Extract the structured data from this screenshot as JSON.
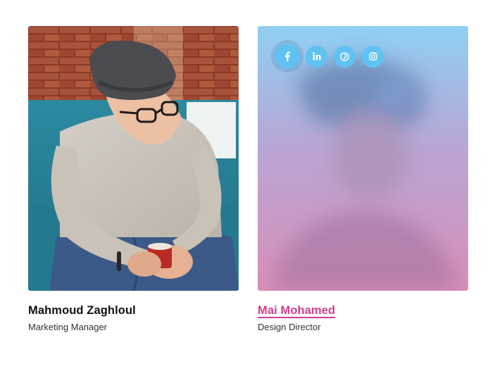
{
  "colors": {
    "accent_pink": "#cf3f8f",
    "social_blue": "#5ec2f2"
  },
  "members": [
    {
      "name": "Mahmoud Zaghloul",
      "role": "Marketing Manager",
      "photo": "man-with-beanie-holding-cup"
    },
    {
      "name": "Mai Mohamed",
      "role": "Design Director",
      "photo": "blurred-portrait-with-gradient-overlay",
      "social": [
        {
          "icon": "facebook-icon",
          "glyph": "f"
        },
        {
          "icon": "linkedin-icon",
          "glyph": "in"
        },
        {
          "icon": "pinterest-icon",
          "glyph": "p"
        },
        {
          "icon": "instagram-icon",
          "glyph": "ig"
        }
      ]
    }
  ]
}
